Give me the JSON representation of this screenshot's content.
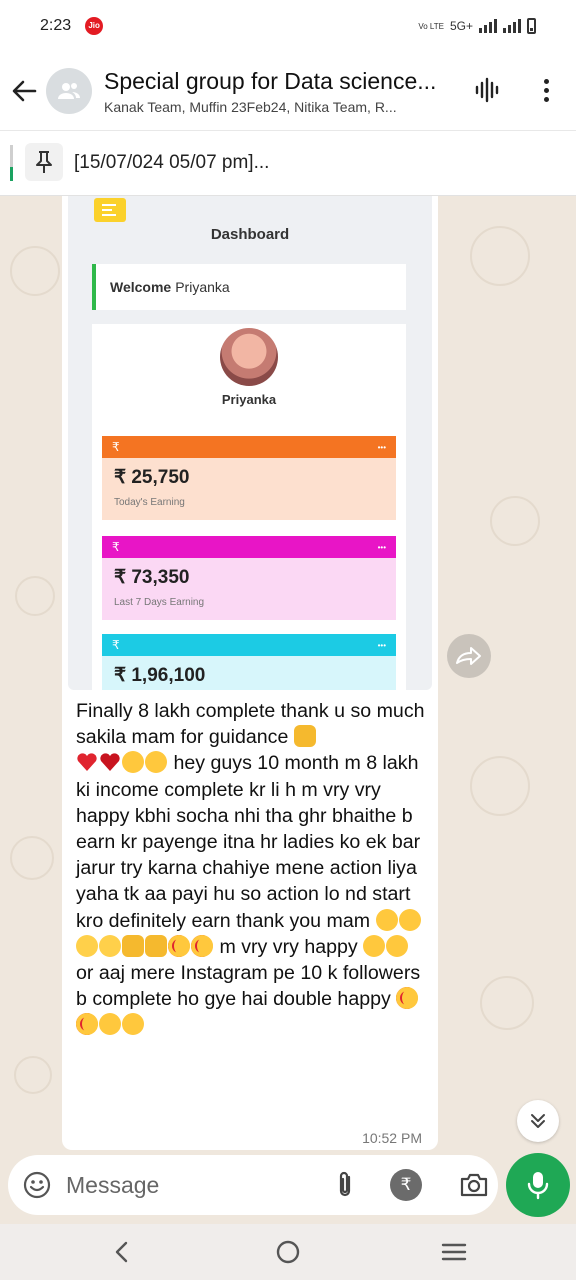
{
  "status_bar": {
    "time": "2:23",
    "carrier_badge": "Jio",
    "network": "5G+",
    "volte_label": "Vo LTE"
  },
  "header": {
    "title": "Special group for Data science...",
    "subtitle": "Kanak Team, Muffin 23Feb24, Nitika Team, R..."
  },
  "pinned": {
    "text": "[15/07/024   05/07 pm]..."
  },
  "shared_screenshot": {
    "title": "Dashboard",
    "welcome_bold": "Welcome",
    "welcome_name": "Priyanka",
    "profile_name": "Priyanka",
    "cards": [
      {
        "currency": "₹",
        "dots": "•••",
        "amount": "₹ 25,750",
        "label": "Today's Earning",
        "head_color": "#f47422",
        "body_color": "#fde0cf"
      },
      {
        "currency": "₹",
        "dots": "•••",
        "amount": "₹ 73,350",
        "label": "Last 7 Days Earning",
        "head_color": "#e815c6",
        "body_color": "#fbd8f4"
      },
      {
        "currency": "₹",
        "dots": "•••",
        "amount": "₹ 1,96,100",
        "label": "",
        "head_color": "#1ccbe4",
        "body_color": "#d7f6fb"
      }
    ]
  },
  "message": {
    "part1": "Finally 8 lakh complete thank u so much sakila  mam for guidance ",
    "part2": " hey guys 10 month m 8 lakh ki income complete  kr li h m vry vry happy kbhi socha nhi tha ghr bhaithe b earn kr payenge itna hr ladies ko ek bar jarur try karna chahiye  mene action liya yaha tk aa payi hu so action lo nd start kro definitely earn thank you mam ",
    "part3": " m vry vry happy ",
    "part4": " or aaj mere Instagram pe 10 k followers b complete ho gye hai double happy ",
    "time": "10:52 PM"
  },
  "input": {
    "placeholder": "Message",
    "rupee_symbol": "₹"
  },
  "colors": {
    "accent_green": "#1fa855",
    "chat_bg": "#efe7dd"
  }
}
